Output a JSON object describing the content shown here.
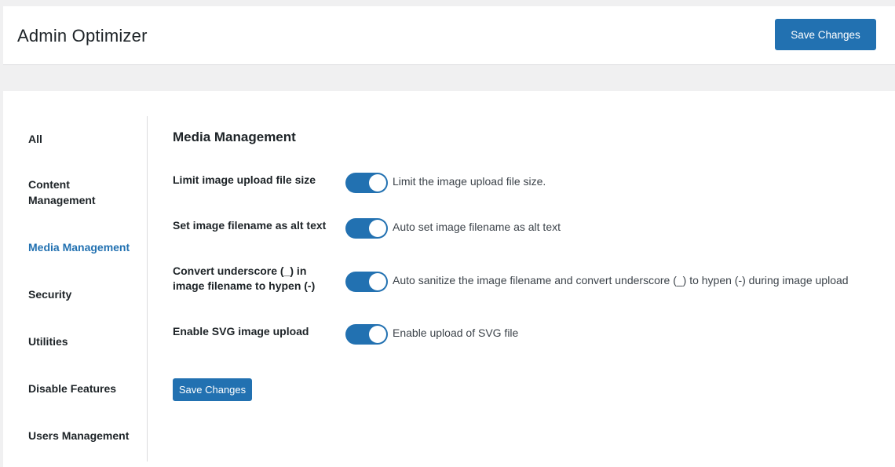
{
  "header": {
    "title": "Admin Optimizer",
    "save_label": "Save Changes"
  },
  "sidebar": {
    "items": [
      {
        "label": "All",
        "active": false
      },
      {
        "label": "Content Management",
        "active": false
      },
      {
        "label": "Media Management",
        "active": true
      },
      {
        "label": "Security",
        "active": false
      },
      {
        "label": "Utilities",
        "active": false
      },
      {
        "label": "Disable Features",
        "active": false
      },
      {
        "label": "Users Management",
        "active": false
      }
    ]
  },
  "main": {
    "section_title": "Media Management",
    "settings": [
      {
        "label": "Limit image upload file size",
        "enabled": true,
        "description": "Limit the image upload file size."
      },
      {
        "label": "Set image filename as alt text",
        "enabled": true,
        "description": "Auto set image filename as alt text"
      },
      {
        "label": "Convert underscore (_) in image filename to hypen (-)",
        "enabled": true,
        "description": "Auto sanitize the image filename and convert underscore (_) to hypen (-) during image upload"
      },
      {
        "label": "Enable SVG image upload",
        "enabled": true,
        "description": "Enable upload of SVG file"
      }
    ],
    "save_label": "Save Changes"
  },
  "colors": {
    "accent": "#2271b1",
    "background": "#f0f0f1",
    "text": "#1d2327"
  }
}
